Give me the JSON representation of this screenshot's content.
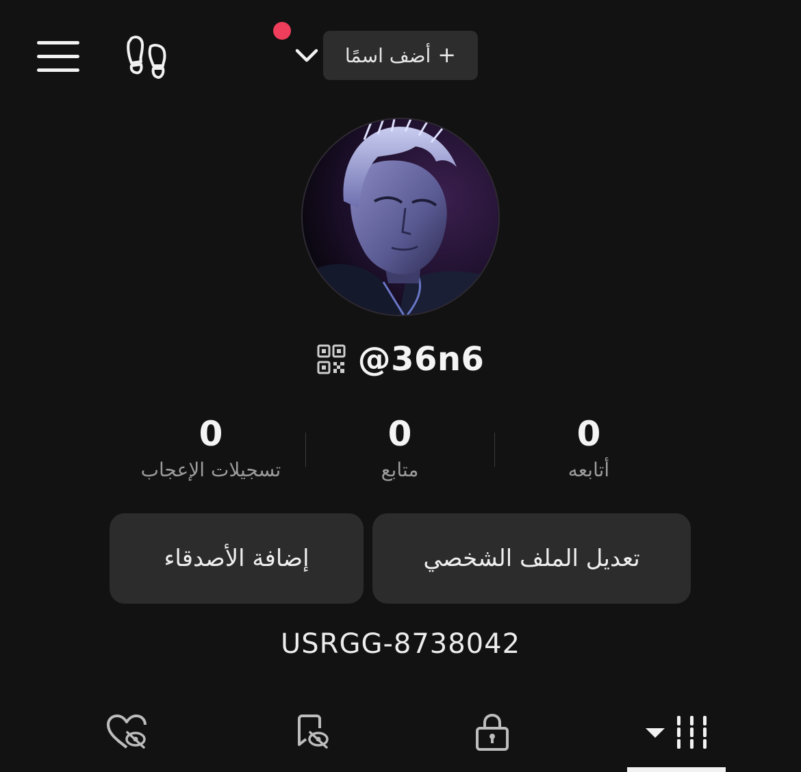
{
  "header": {
    "add_name_label": "أضف اسمًا",
    "add_name_plus": "+",
    "icons": [
      "menu-icon",
      "footprint-icon",
      "chevron-down-icon"
    ],
    "notification_dot_color": "#ee3e5b"
  },
  "profile": {
    "username": "@36n6",
    "user_id": "USRGG-8738042"
  },
  "stats": {
    "following": {
      "count": "0",
      "label": "أتابعه"
    },
    "followers": {
      "count": "0",
      "label": "متابع"
    },
    "likes": {
      "count": "0",
      "label": "تسجيلات الإعجاب"
    }
  },
  "buttons": {
    "edit_profile": "تعديل الملف الشخصي",
    "add_friends": "إضافة الأصدقاء"
  },
  "tabs": [
    {
      "name": "videos-grid",
      "icon": "grid-columns-icon",
      "active": true
    },
    {
      "name": "private",
      "icon": "lock-icon",
      "active": false
    },
    {
      "name": "favorites",
      "icon": "bookmark-hidden-icon",
      "active": false
    },
    {
      "name": "liked",
      "icon": "heart-hidden-icon",
      "active": false
    }
  ],
  "colors": {
    "background": "#121212",
    "button": "#2c2c2c",
    "accent_dot": "#ee3e5b"
  }
}
